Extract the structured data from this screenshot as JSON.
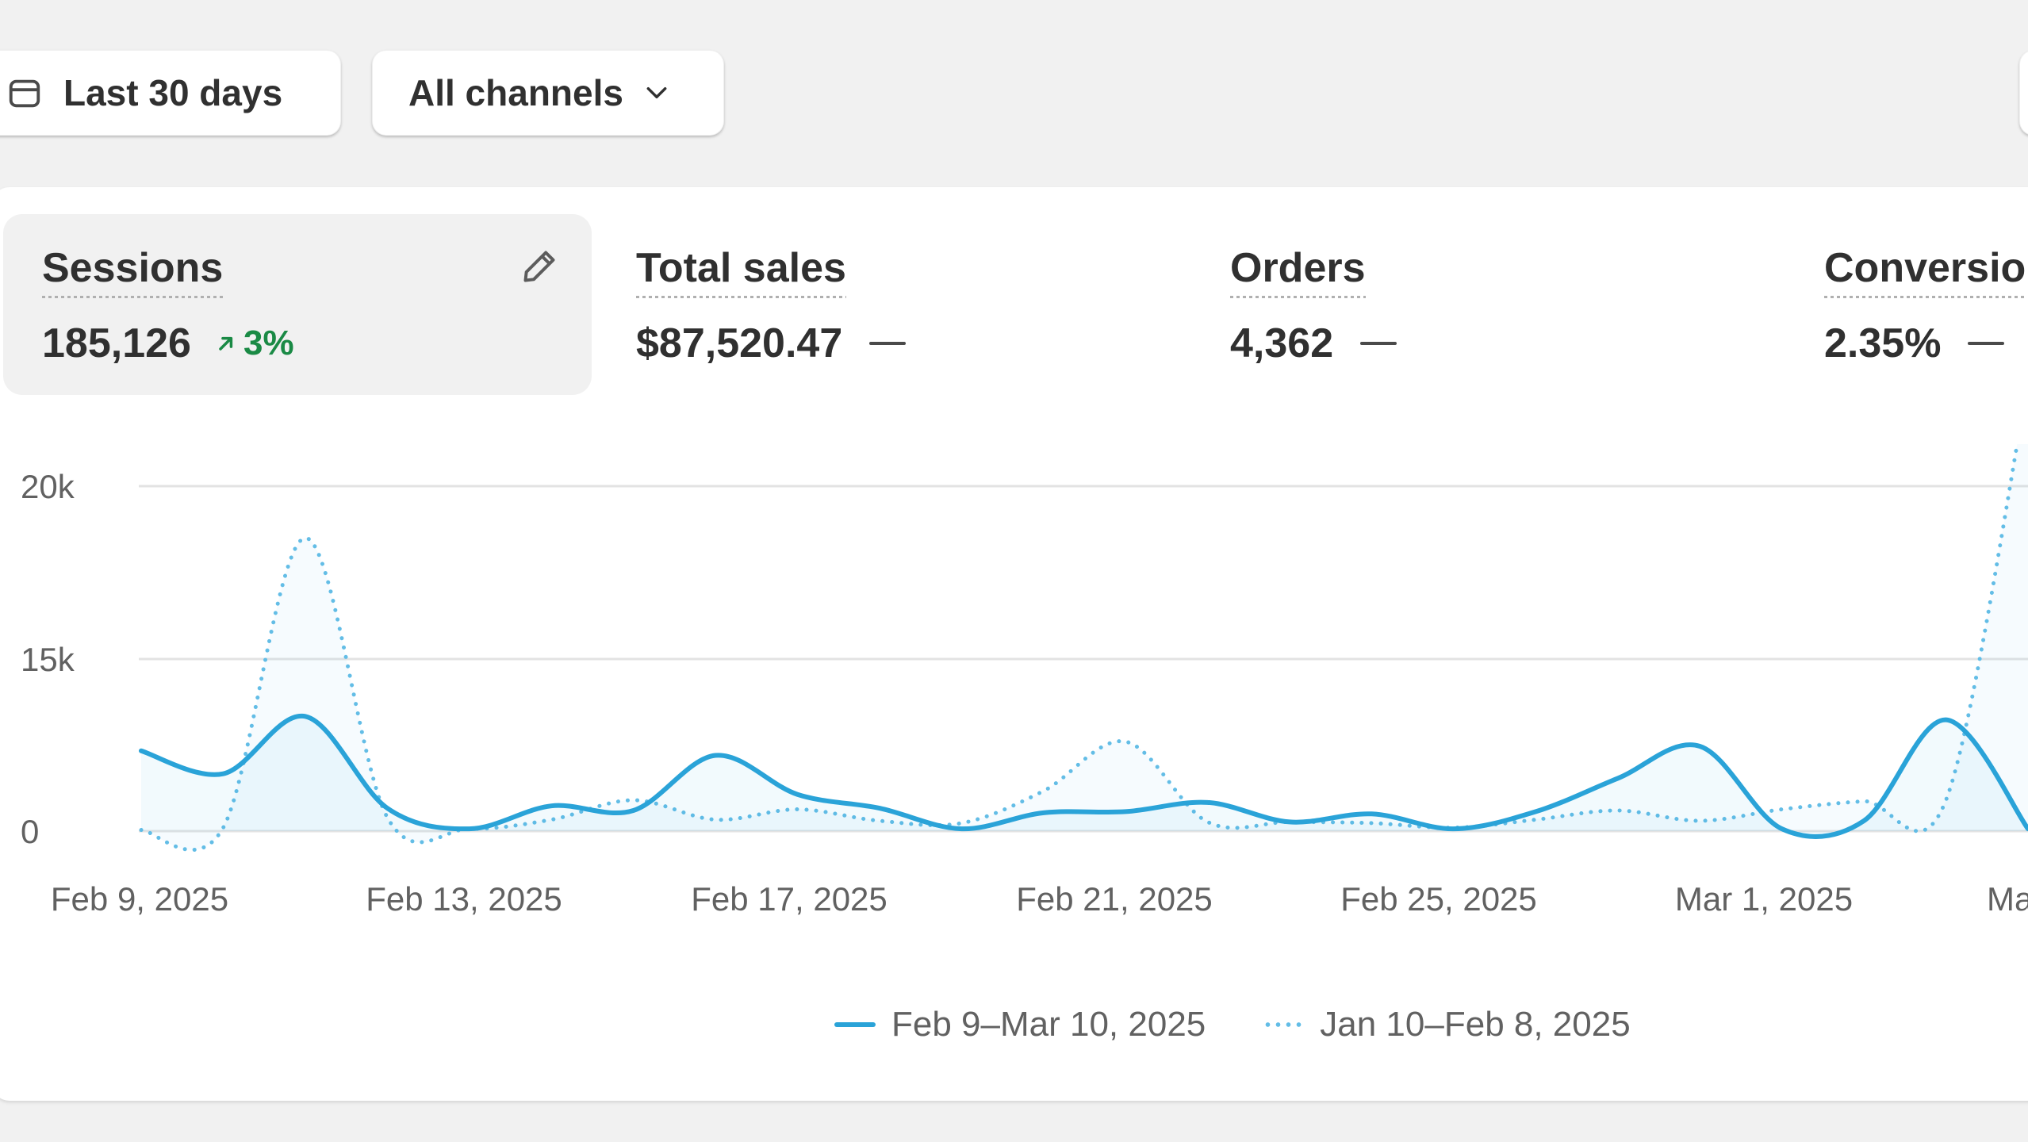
{
  "toolbar": {
    "date_range_label": "Last 30 days",
    "channels_label": "All channels",
    "icons": {
      "calendar": "calendar-icon",
      "chevron": "chevron-down-icon"
    }
  },
  "metrics": [
    {
      "label": "Sessions",
      "value": "185,126",
      "change": "3%",
      "change_direction": "up",
      "active": true
    },
    {
      "label": "Total sales",
      "value": "$87,520.47",
      "change": "—"
    },
    {
      "label": "Orders",
      "value": "4,362",
      "change": "—"
    },
    {
      "label": "Conversio",
      "value": "2.35%",
      "change": "—"
    }
  ],
  "colors": {
    "accent": "#2aa3d8",
    "comparison": "#63bde6",
    "positive": "#1a8a45",
    "gridline": "#e3e3e3"
  },
  "chart_data": {
    "type": "line",
    "yticks": [
      "0",
      "15k",
      "20k"
    ],
    "ylim": [
      0,
      20000
    ],
    "xticks": [
      "Feb 9, 2025",
      "Feb 13, 2025",
      "Feb 17, 2025",
      "Feb 21, 2025",
      "Feb 25, 2025",
      "Mar 1, 2025",
      "Ma"
    ],
    "grid": true,
    "legend_position": "bottom-center",
    "series": [
      {
        "name": "Feb 9–Mar 10, 2025",
        "style": "solid",
        "values": [
          7000,
          5000,
          10000,
          2000,
          200,
          2200,
          1800,
          6600,
          3200,
          2000,
          200,
          1600,
          1700,
          2500,
          800,
          1500,
          200,
          1700,
          4600,
          7400,
          200,
          900,
          9700,
          200
        ]
      },
      {
        "name": "Jan 10–Feb 8, 2025",
        "style": "dotted",
        "values": [
          100,
          300,
          18500,
          1200,
          200,
          1000,
          2700,
          1000,
          1900,
          900,
          700,
          3500,
          7800,
          800,
          800,
          700,
          300,
          1000,
          1800,
          900,
          1900,
          2600,
          2700,
          23000
        ]
      }
    ]
  }
}
